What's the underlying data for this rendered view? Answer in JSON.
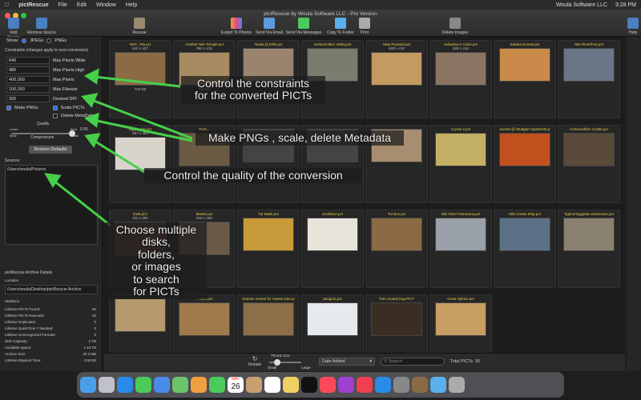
{
  "menubar": {
    "app": "pictRescue",
    "items": [
      "File",
      "Edit",
      "Window",
      "Help"
    ],
    "right_items": [
      "Woula Software LLC",
      "3:28 PM"
    ]
  },
  "window": {
    "title": "pictRescue by Woula Software LLC - Pro Version"
  },
  "toolbar": {
    "add_source": "Add Source",
    "remove_source": "Remove Source",
    "rescue": "Rescue",
    "export_photos": "Export To Photos",
    "send_email": "Send Via Email",
    "send_messages": "Send Via Messages",
    "copy_folder": "Copy To Folder",
    "print": "Print",
    "delete_images": "Delete Images",
    "help": "Help"
  },
  "sidebar": {
    "show_label": "Show:",
    "show_jpegs": "JPEGs",
    "show_pngs": "PNGs",
    "constraints_title": "Constraints (changes apply to next conversion)",
    "constraints": [
      {
        "value": "640",
        "label": "Max Pixels Wide"
      },
      {
        "value": "480",
        "label": "Max Pixels High"
      },
      {
        "value": "400,000",
        "label": "Max Pixels"
      },
      {
        "value": "100,000",
        "label": "Max Filesize"
      },
      {
        "value": "300",
        "label": "Desired DPI"
      }
    ],
    "make_pngs": "Make PNGs",
    "scale_picts": "Scale PICTs",
    "delete_metadata": "Delete MetaData",
    "quality_label": "Quality",
    "least": "Least",
    "best": "Best",
    "most": "Most",
    "least2": "Least",
    "quality_value": "0.95",
    "compression_label": "Compression",
    "restore_defaults": "Restore Defaults",
    "sources_title": "Sources",
    "source_path": "/Users/woula/Pictures",
    "archive_title": "pictRescue Archive Details",
    "location_label": "Location",
    "archive_path": "/Users/woula/Desktop/pictRescue Archive",
    "stats_title": "Statistics",
    "stats": [
      {
        "label": "Lifetime PICTs Found:",
        "value": "50"
      },
      {
        "label": "Lifetime PICTs Rescued:",
        "value": "30"
      },
      {
        "label": "Lifetime Duplicates:",
        "value": "0"
      },
      {
        "label": "Lifetime QuickTime 7 Needed:",
        "value": "0"
      },
      {
        "label": "Lifetime Unrecognized Formats:",
        "value": "0"
      },
      {
        "label": "Disk Capacity:",
        "value": "2 TB"
      },
      {
        "label": "Available Space:",
        "value": "1.43 TB"
      },
      {
        "label": "Archive Size:",
        "value": "40.3 MB"
      },
      {
        "label": "Lifetime Elapsed Time:",
        "value": "0:00:00"
      }
    ]
  },
  "grid": [
    {
      "name": "NKP_765.pct",
      "dims": "640 x 437",
      "size": "703 KB",
      "color": "#8b6b45"
    },
    {
      "name": "Another Nile Temple.pct",
      "dims": "584 x 415",
      "size": "470 KB",
      "color": "#a88b60"
    },
    {
      "name": "Taxila @ Edfu.pct",
      "dims": "",
      "size": "",
      "color": "#9a8470"
    },
    {
      "name": "Hohenzollern Valley.pct",
      "dims": "",
      "size": "",
      "color": "#7a7d6e"
    },
    {
      "name": "Step Pyramid.pct",
      "dims": "608 x 416",
      "size": "",
      "color": "#c49a60"
    },
    {
      "name": "Suburbia in Cairo.pct",
      "dims": "608 x 416",
      "size": "",
      "color": "#8a7462"
    },
    {
      "name": "Sahara Sunset.pct",
      "dims": "",
      "size": "",
      "color": "#c98a4a"
    },
    {
      "name": "Nile Riverfront.pct",
      "dims": "",
      "size": "",
      "color": "#6a7588"
    },
    {
      "name": "egyptgods.pct",
      "dims": "367 x 480",
      "size": "",
      "color": "#d8d4cc"
    },
    {
      "name": "Tut's...",
      "dims": "",
      "size": "",
      "color": "#6a5a44"
    },
    {
      "name": "",
      "dims": "",
      "size": "",
      "color": "#444"
    },
    {
      "name": "",
      "dims": "",
      "size": "",
      "color": "#444"
    },
    {
      "name": "",
      "dims": "",
      "size": "",
      "color": "#a88e70"
    },
    {
      "name": "coyote 2.pct",
      "dims": "",
      "size": "",
      "color": "#c4b064"
    },
    {
      "name": "sunset @ Stuttgart Apartment.p",
      "dims": "",
      "size": "",
      "color": "#c2501e"
    },
    {
      "name": "Hohenzollern Castle.pct",
      "dims": "",
      "size": "",
      "color": "#5a4a3a"
    },
    {
      "name": "lew5.pict",
      "dims": "422 x 291",
      "size": "",
      "color": "#5a3a2a"
    },
    {
      "name": "Master.pct",
      "dims": "640 x 460",
      "size": "",
      "color": "#6b5a48"
    },
    {
      "name": "Tut Mask.pct",
      "dims": "",
      "size": "",
      "color": "#c89a3a"
    },
    {
      "name": "clockface.pct",
      "dims": "",
      "size": "",
      "color": "#e8e4dc"
    },
    {
      "name": "Tut Box.pct",
      "dims": "",
      "size": "",
      "color": "#8a6a44"
    },
    {
      "name": "Nile River Panorama.pct",
      "dims": "",
      "size": "",
      "color": "#9aa0a8"
    },
    {
      "name": "Nile Cruise Ship.pct",
      "dims": "",
      "size": "",
      "color": "#5c7086"
    },
    {
      "name": "Typical Egyptian Downtown.pct",
      "dims": "",
      "size": "",
      "color": "#8a8170"
    },
    {
      "name": "",
      "dims": "",
      "size": "",
      "color": "#b49a6c"
    },
    {
      "name": "...mple.pct",
      "dims": "",
      "size": "",
      "color": "#a07a4c"
    },
    {
      "name": "Statues moved for Aswan Dam.p",
      "dims": "",
      "size": "",
      "color": "#8c6e48"
    },
    {
      "name": "penguin.pct",
      "dims": "",
      "size": "",
      "color": "#e6eaee"
    },
    {
      "name": "Tut's Guard Dog.PICT",
      "dims": "",
      "size": "",
      "color": "#3a2e22"
    },
    {
      "name": "Great Sphinx.pct",
      "dims": "",
      "size": "",
      "color": "#c89e62"
    }
  ],
  "bottombar": {
    "rotate": "Rotate",
    "thumb_size": "Thumb Size",
    "small": "Small",
    "large": "Large",
    "sort": "Date Added",
    "search_placeholder": "Search",
    "total": "Total PICTs: 30"
  },
  "annotations": {
    "a1": "Control the constraints\nfor the converted PICTs",
    "a2": "Make PNGs , scale, delete Metadata",
    "a3": "Control the quality of the conversion",
    "a4": "Choose multiple\ndisks,\nfolders,\nor images\nto search\nfor PICTs"
  },
  "dock": [
    "Finder",
    "Launchpad",
    "Safari",
    "Messages",
    "Mail",
    "Maps",
    "Photos",
    "FaceTime",
    "Calendar",
    "Contacts",
    "Reminders",
    "Notes",
    "TV",
    "Music",
    "Podcasts",
    "News",
    "App Store",
    "System Preferences",
    "pictRescue",
    "Downloads",
    "Trash"
  ],
  "calendar": {
    "month": "MAY",
    "day": "26"
  }
}
